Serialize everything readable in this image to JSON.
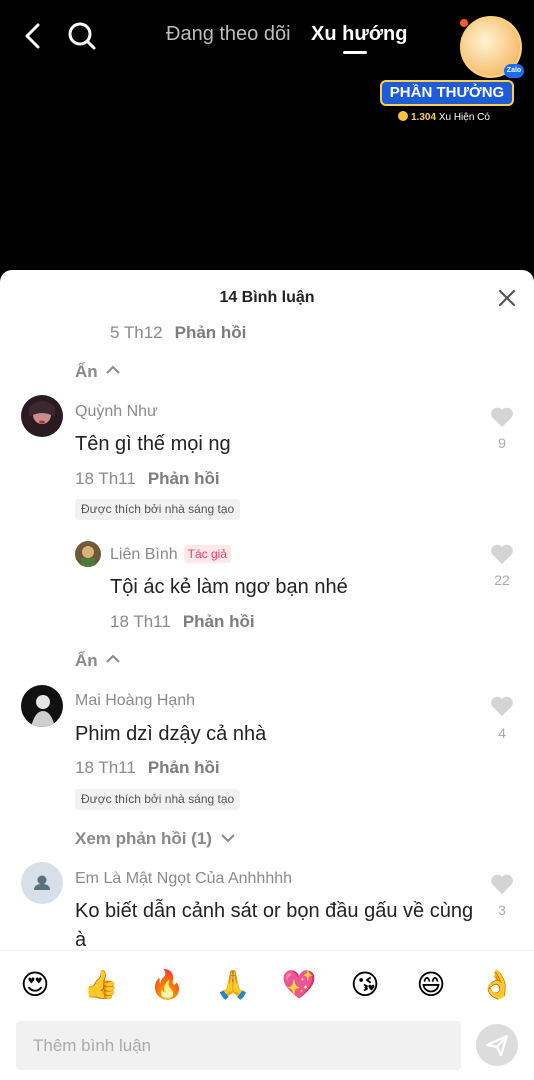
{
  "header": {
    "tab_following": "Đang theo dõi",
    "tab_trending": "Xu hướng",
    "reward_label": "PHẦN THƯỞNG",
    "reward_coins_value": "1.304",
    "reward_coins_suffix": "Xu Hiện Có",
    "zalo_badge": "Zalo"
  },
  "comments_sheet": {
    "title": "14 Bình luận",
    "prev_reply_meta": {
      "date": "5 Th12",
      "reply": "Phản hồi"
    },
    "hide_1": "Ẩn",
    "hide_2": "Ẩn",
    "comments": [
      {
        "name": "Quỳnh Như",
        "text": "Tên gì thế mọi ng",
        "date": "18 Th11",
        "reply": "Phản hồi",
        "liked_badge": "Được thích bởi nhà sáng tạo",
        "likes": "9"
      },
      {
        "name": "Liên Bình",
        "author_tag": "Tác giả",
        "text": "Tội ác kẻ làm ngơ bạn nhé",
        "date": "18 Th11",
        "reply": "Phản hồi",
        "likes": "22"
      },
      {
        "name": "Mai Hoàng Hạnh",
        "text": "Phim dzì dzậy cả nhà",
        "date": "18 Th11",
        "reply": "Phản hồi",
        "liked_badge": "Được thích bởi nhà sáng tạo",
        "likes": "4",
        "view_replies": "Xem phản hồi (1)"
      },
      {
        "name": "Em Là Mật Ngọt Của Anhhhhh",
        "text": "Ko biết dẫn cảnh sát or bọn đầu gấu về cùng à",
        "likes": "3"
      }
    ]
  },
  "emoji_bar": [
    "😍",
    "👍",
    "🔥",
    "🙏",
    "💖",
    "😘",
    "😄",
    "👌"
  ],
  "comment_input": {
    "placeholder": "Thêm bình luận"
  },
  "colors": {
    "accent_red": "#ff3b5c",
    "reward_blue": "#1e5bd8",
    "heart_gray": "#d4d4d4"
  }
}
